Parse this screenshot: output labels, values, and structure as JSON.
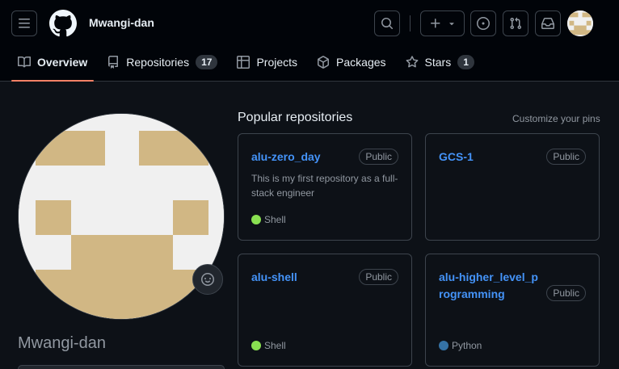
{
  "header": {
    "username": "Mwangi-dan"
  },
  "tabs": [
    {
      "label": "Overview",
      "icon": "book-icon",
      "active": true
    },
    {
      "label": "Repositories",
      "icon": "repo-icon",
      "count": "17"
    },
    {
      "label": "Projects",
      "icon": "table-icon"
    },
    {
      "label": "Packages",
      "icon": "package-icon"
    },
    {
      "label": "Stars",
      "icon": "star-icon",
      "count": "1"
    }
  ],
  "profile": {
    "name": "Mwangi-dan"
  },
  "popular": {
    "title": "Popular repositories",
    "customize_label": "Customize your pins",
    "repos": [
      {
        "name": "alu-zero_day",
        "visibility": "Public",
        "description": "This is my first repository as a full-stack engineer",
        "language": "Shell",
        "language_color": "#89e051"
      },
      {
        "name": "GCS-1",
        "visibility": "Public",
        "description": "",
        "language": "",
        "language_color": ""
      },
      {
        "name": "alu-shell",
        "visibility": "Public",
        "description": "",
        "language": "Shell",
        "language_color": "#89e051"
      },
      {
        "name": "alu-higher_level_programming",
        "visibility": "Public",
        "description": "",
        "language": "Python",
        "language_color": "#3572A5"
      }
    ]
  },
  "colors": {
    "background": "#0d1117",
    "header": "#010409",
    "link": "#4493f8",
    "active_tab_underline": "#f78166",
    "avatar_tan": "#d1b784",
    "avatar_light": "#f0f0f0"
  }
}
